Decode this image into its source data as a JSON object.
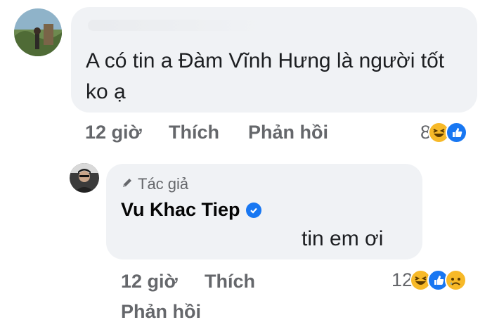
{
  "comment1": {
    "text": "A có tin a Đàm Vĩnh Hưng là người tốt ko ạ",
    "time": "12 giờ",
    "like_label": "Thích",
    "reply_label": "Phản hồi",
    "reaction_count": "8",
    "reactions": [
      "haha-icon",
      "like-icon"
    ]
  },
  "comment2": {
    "author_badge": "Tác giả",
    "author_name": "Vu Khac Tiep",
    "text": "tin em ơi",
    "time": "12 giờ",
    "like_label": "Thích",
    "reply_label": "Phản hồi",
    "reaction_count": "12",
    "reactions": [
      "haha-icon",
      "like-icon",
      "sad-icon"
    ]
  },
  "colors": {
    "bubble": "#f0f2f5",
    "meta_text": "#65676b",
    "like_blue": "#1877f2",
    "emoji_yellow": "#f7b928"
  }
}
